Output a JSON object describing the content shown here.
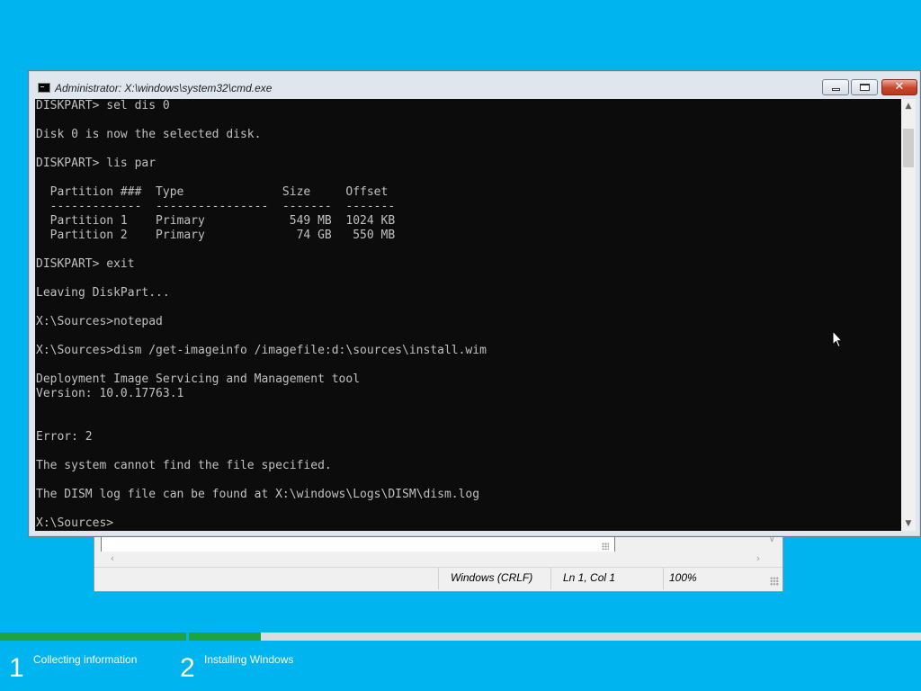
{
  "notepad": {
    "status_line_ending": "Windows (CRLF)",
    "status_position": "Ln 1, Col 1",
    "status_zoom": "100%"
  },
  "cmd": {
    "title": "Administrator: X:\\windows\\system32\\cmd.exe",
    "lines": [
      "DISKPART> sel dis 0",
      "",
      "Disk 0 is now the selected disk.",
      "",
      "DISKPART> lis par",
      "",
      "  Partition ###  Type              Size     Offset",
      "  -------------  ----------------  -------  -------",
      "  Partition 1    Primary            549 MB  1024 KB",
      "  Partition 2    Primary             74 GB   550 MB",
      "",
      "DISKPART> exit",
      "",
      "Leaving DiskPart...",
      "",
      "X:\\Sources>notepad",
      "",
      "X:\\Sources>dism /get-imageinfo /imagefile:d:\\sources\\install.wim",
      "",
      "Deployment Image Servicing and Management tool",
      "Version: 10.0.17763.1",
      "",
      "",
      "Error: 2",
      "",
      "The system cannot find the file specified.",
      "",
      "The DISM log file can be found at X:\\windows\\Logs\\DISM\\dism.log",
      "",
      "X:\\Sources>"
    ]
  },
  "setup": {
    "steps": [
      {
        "number": "1",
        "label": "Collecting information"
      },
      {
        "number": "2",
        "label": "Installing Windows"
      }
    ],
    "progress_fraction": 0.283,
    "colors": {
      "background": "#00b4f0",
      "progress": "#1ea33d"
    }
  }
}
